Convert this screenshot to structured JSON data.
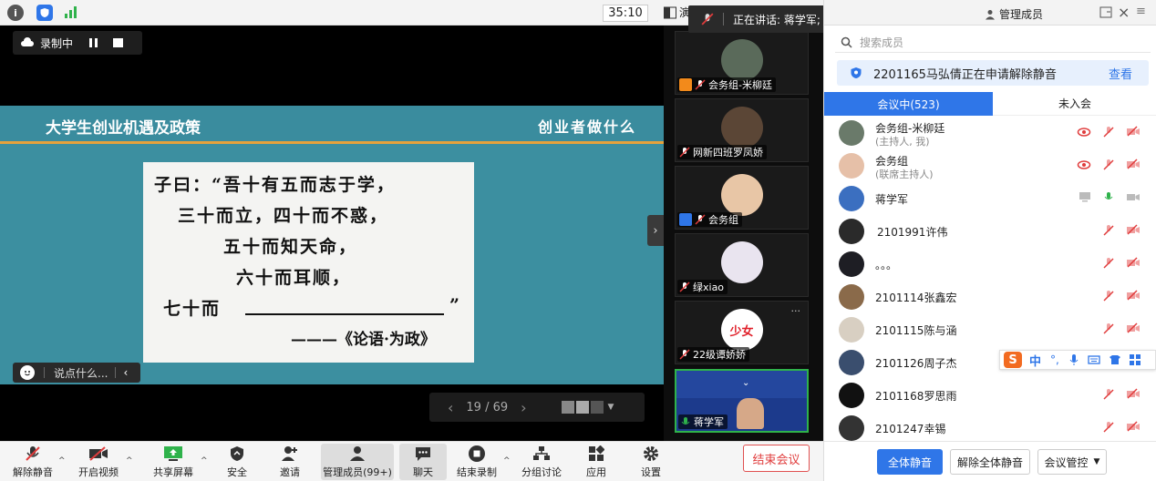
{
  "topbar": {
    "timer": "35:10",
    "present_label": "演"
  },
  "speaking": {
    "text": "正在讲话: 蒋学军;"
  },
  "recording": {
    "label": "录制中"
  },
  "slide": {
    "title": "大学生创业机遇及政策",
    "subtitle": "创业者做什么",
    "quote_lines": [
      "子曰：“吾十有五而志于学，",
      "三十而立，四十而不惑，",
      "五十而知天命，",
      "六十而耳顺，",
      "七十而",
      "”",
      "———《论语·为政》"
    ]
  },
  "chat": {
    "placeholder": "说点什么..."
  },
  "pager": {
    "text": "19 / 69"
  },
  "tiles": [
    {
      "name": "会务组-米柳廷"
    },
    {
      "name": "网新四班罗凤娇"
    },
    {
      "name": "会务组"
    },
    {
      "name": "绿xiao"
    },
    {
      "name": "22级谭娇娇",
      "avatar_text": "少女"
    },
    {
      "name": "蒋学军"
    }
  ],
  "toolbar": {
    "unmute": "解除静音",
    "video": "开启视频",
    "share": "共享屏幕",
    "security": "安全",
    "invite": "邀请",
    "members": "管理成员(99+)",
    "chat": "聊天",
    "stop_record": "结束录制",
    "breakout": "分组讨论",
    "apps": "应用",
    "settings": "设置",
    "end": "结束会议"
  },
  "panel": {
    "title": "管理成员",
    "search_placeholder": "搜索成员",
    "notice": "2201165马弘倩正在申请解除静音",
    "notice_action": "查看",
    "tab_in": "会议中(523)",
    "tab_out": "未入会",
    "members": [
      {
        "name": "会务组-米柳廷",
        "role": "(主持人, 我)"
      },
      {
        "name": "会务组",
        "role": "(联席主持人)"
      },
      {
        "name": "蒋学军",
        "role": ""
      },
      {
        "name": "2101991许伟",
        "role": ""
      },
      {
        "name": "。。。",
        "role": ""
      },
      {
        "name": "2101114张鑫宏",
        "role": ""
      },
      {
        "name": "2101115陈与涵",
        "role": ""
      },
      {
        "name": "2101126周子杰",
        "role": ""
      },
      {
        "name": "2101168罗思雨",
        "role": ""
      },
      {
        "name": "2101247幸锡",
        "role": ""
      }
    ],
    "mute_all": "全体静音",
    "unmute_all": "解除全体静音",
    "control": "会议管控"
  },
  "ime": {
    "lang": "中"
  },
  "colors": {
    "accent": "#2f76e8",
    "danger": "#e03c3c",
    "slide_bg": "#3c8fa0",
    "slide_rule": "#e6a23c"
  }
}
